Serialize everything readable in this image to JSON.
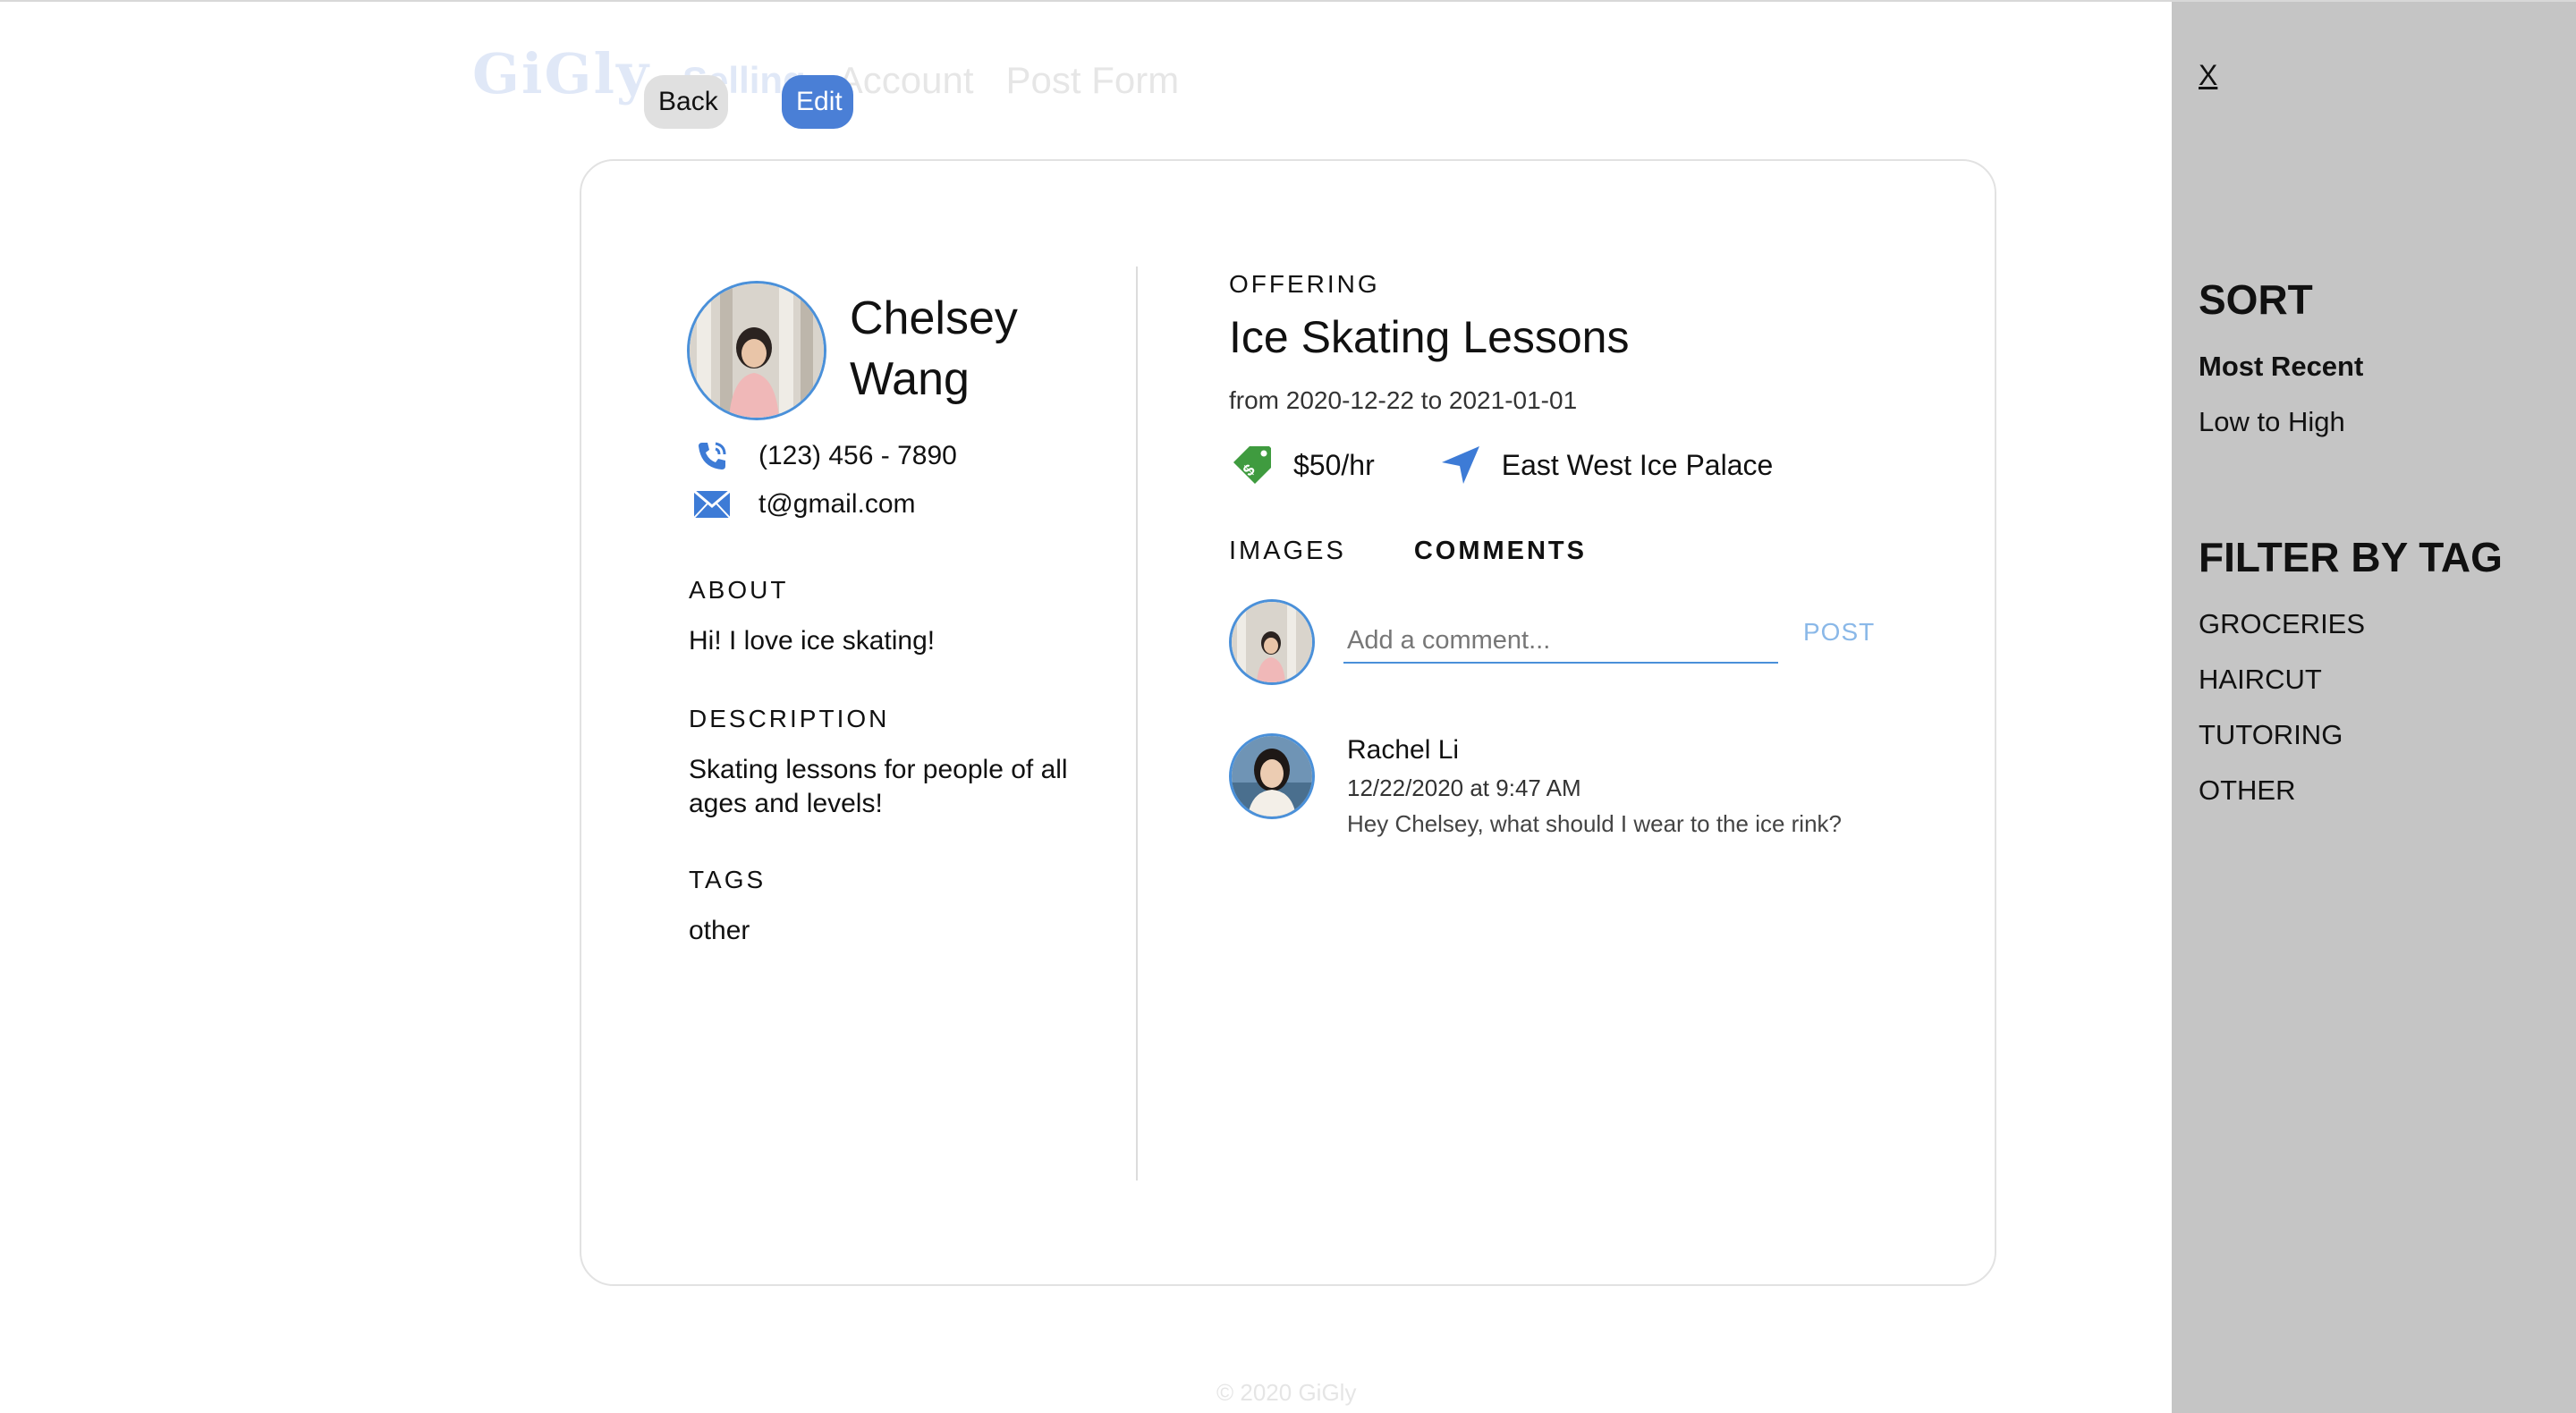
{
  "header": {
    "logo": "GiGly",
    "nav": [
      "Selling",
      "Account",
      "Post Form"
    ]
  },
  "footer": "© 2020 GiGly",
  "buttons": {
    "back": "Back",
    "edit": "Edit"
  },
  "profile": {
    "name": "Chelsey Wang",
    "phone": "(123) 456 - 7890",
    "email": "t@gmail.com",
    "about_label": "ABOUT",
    "about": "Hi! I love ice skating!",
    "description_label": "DESCRIPTION",
    "description": "Skating lessons for people of all ages and levels!",
    "tags_label": "TAGS",
    "tags": "other"
  },
  "offering": {
    "label": "OFFERING",
    "title": "Ice Skating Lessons",
    "dates": "from 2020-12-22 to 2021-01-01",
    "price": "$50/hr",
    "location": "East West Ice Palace"
  },
  "tabs": {
    "images": "IMAGES",
    "comments": "COMMENTS"
  },
  "comment_form": {
    "placeholder": "Add a comment...",
    "post": "POST"
  },
  "comments": [
    {
      "author": "Rachel Li",
      "time": "12/22/2020 at 9:47 AM",
      "text": "Hey Chelsey, what should I wear to the ice rink?"
    }
  ],
  "sidebar": {
    "close": "X",
    "sort_heading": "SORT",
    "sort_options": [
      "Most Recent",
      "Low to High"
    ],
    "filter_heading": "FILTER BY TAG",
    "filter_options": [
      "GROCERIES",
      "HAIRCUT",
      "TUTORING",
      "OTHER"
    ]
  },
  "colors": {
    "accent": "#4a7fd6",
    "avatar_border": "#4a90d9",
    "price_tag": "#3f9b3f",
    "sidebar_bg": "#c5c5c5"
  }
}
